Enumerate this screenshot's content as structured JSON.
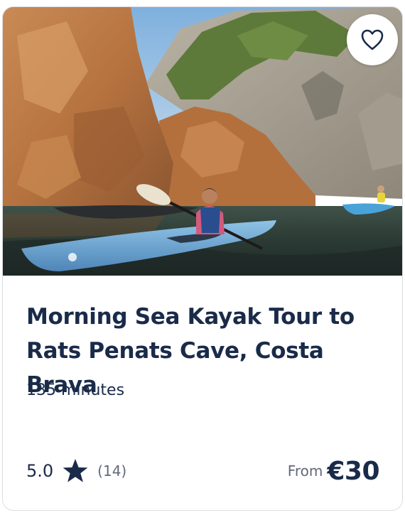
{
  "card": {
    "title": "Morning Sea Kayak Tour to Rats Penats Cave, Costa Brava",
    "duration": "135 minutes",
    "rating": "5.0",
    "review_count": "(14)",
    "price_prefix": "From",
    "price": "€30"
  },
  "icons": {
    "favorite": "heart-outline-icon",
    "rating": "star-icon"
  },
  "colors": {
    "text_primary": "#1a2b49",
    "text_secondary": "#63687a",
    "border": "#dcdde3"
  }
}
